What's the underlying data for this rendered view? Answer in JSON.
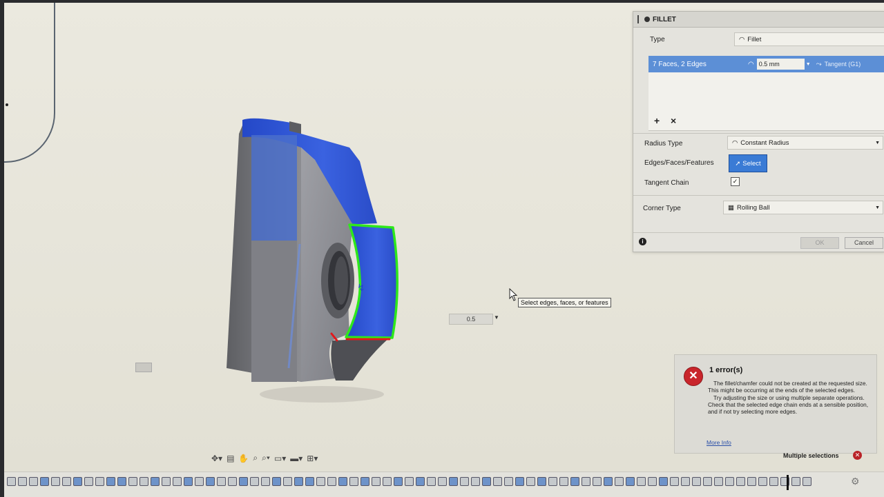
{
  "panel": {
    "title": "FILLET",
    "type_label": "Type",
    "type_value": "Fillet",
    "selection_summary": "7 Faces, 2 Edges",
    "radius_value": "0.5 mm",
    "continuity": "Tangent (G1)",
    "add_label": "+",
    "remove_label": "×",
    "radius_type_label": "Radius Type",
    "radius_type_value": "Constant Radius",
    "edges_label": "Edges/Faces/Features",
    "select_button": "Select",
    "tangent_chain_label": "Tangent Chain",
    "tangent_chain_checked": true,
    "corner_type_label": "Corner Type",
    "corner_type_value": "Rolling Ball",
    "ok_label": "OK",
    "cancel_label": "Cancel"
  },
  "viewport": {
    "dimension_value": "0.5",
    "tooltip": "Select edges, faces, or features"
  },
  "error": {
    "title": "1 error(s)",
    "message": "The fillet/chamfer could not be created at the requested size. This might be occurring at the ends of the selected edges.",
    "suggestion": "Try adjusting the size or using multiple separate operations. Check that the selected edge chain ends at a sensible position, and if not try selecting more edges.",
    "link": "More Info"
  },
  "status": {
    "selection_text": "Multiple selections"
  },
  "colors": {
    "selection_blue": "#3a62d8",
    "highlight_green": "#2ee81b",
    "highlight_red": "#e3181b",
    "error_red": "#c9252b"
  }
}
